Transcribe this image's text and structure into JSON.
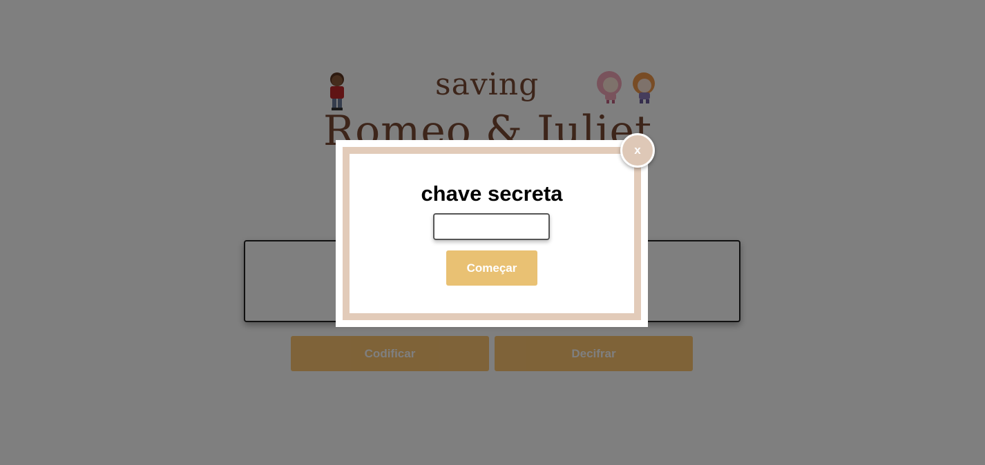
{
  "app": {
    "logo": {
      "top_text": "saving",
      "title_text": "Romeo & Juliet"
    },
    "buttons": {
      "encode_label": "Codificar",
      "decode_label": "Decifrar"
    },
    "message_input": {
      "value": "",
      "placeholder": ""
    }
  },
  "modal": {
    "title": "chave secreta",
    "secret_input": {
      "value": "",
      "placeholder": ""
    },
    "start_label": "Começar",
    "close_label": "x"
  },
  "colors": {
    "brand_brown": "#7a4a34",
    "button_gold": "#e9c173",
    "frame_beige": "#e2cbb9"
  }
}
